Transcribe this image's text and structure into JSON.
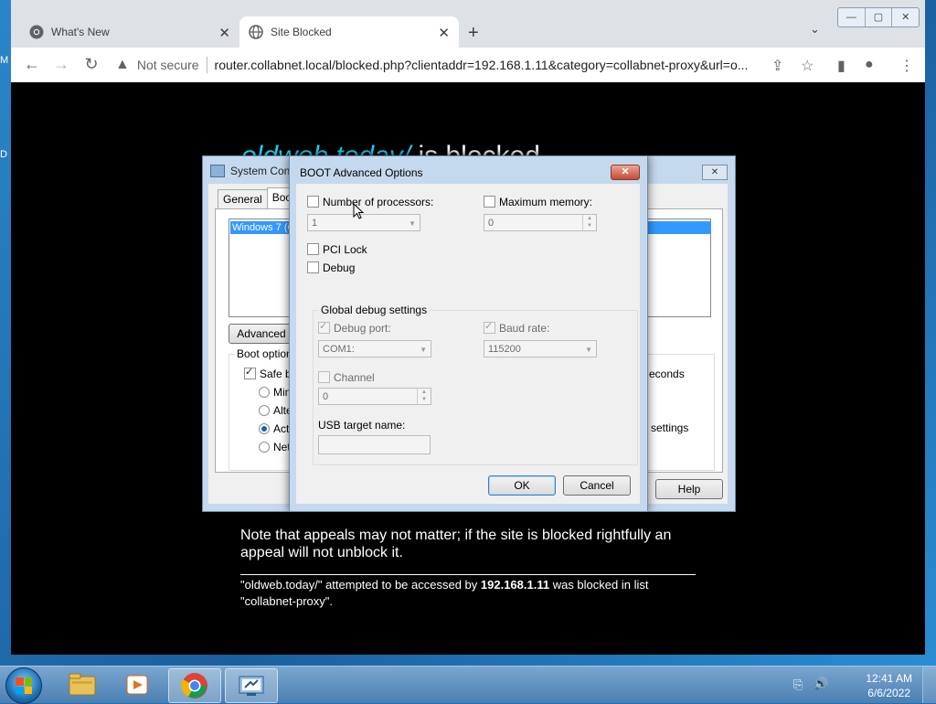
{
  "desktop": {
    "edge_letters": [
      "M",
      "D"
    ]
  },
  "browser": {
    "tabs": [
      {
        "title": "What's New",
        "icon": "chrome-icon",
        "active": false
      },
      {
        "title": "Site Blocked",
        "icon": "globe-icon",
        "active": true
      }
    ],
    "window_controls": {
      "minimize": "—",
      "maximize": "▢",
      "close": "✕"
    },
    "omnibox": {
      "security_label": "Not secure",
      "url": "router.collabnet.local/blocked.php?clientaddr=192.168.1.11&category=collabnet-proxy&url=o..."
    }
  },
  "page": {
    "heading_link": "oldweb.today/",
    "heading_rest": " is blocked",
    "note": "Note that appeals may not matter; if the site is blocked rightfully an appeal will not unblock it.",
    "attempt_pre": "\"oldweb.today/\" attempted to be accessed by ",
    "attempt_ip": "192.168.1.11",
    "attempt_mid": " was blocked in list",
    "attempt_list": "\"collabnet-proxy\"."
  },
  "system_config": {
    "title": "System Conf",
    "tabs": [
      "General",
      "Boot"
    ],
    "os_entry": "Windows 7 (C",
    "advanced_button": "Advanced o",
    "boot_options_label": "Boot options",
    "safe_boot_label": "Safe bo",
    "safe_boot_checked": true,
    "radios": [
      {
        "label": "Mini",
        "selected": false
      },
      {
        "label": "Alte",
        "selected": false
      },
      {
        "label": "Activ",
        "selected": true
      },
      {
        "label": "Netw",
        "selected": false
      }
    ],
    "timeout_suffix": "econds",
    "settings_label": "settings",
    "help_button": "Help"
  },
  "advanced_dialog": {
    "title": "BOOT Advanced Options",
    "close": "✕",
    "num_processors_label": "Number of processors:",
    "num_processors_checked": false,
    "num_processors_value": "1",
    "max_memory_label": "Maximum memory:",
    "max_memory_checked": false,
    "max_memory_value": "0",
    "pci_lock_label": "PCI Lock",
    "pci_lock_checked": false,
    "debug_label": "Debug",
    "debug_checked": false,
    "global_debug_label": "Global debug settings",
    "debug_port_label": "Debug port:",
    "debug_port_checked": true,
    "debug_port_value": "COM1:",
    "baud_rate_label": "Baud rate:",
    "baud_rate_checked": true,
    "baud_rate_value": "115200",
    "channel_label": "Channel",
    "channel_checked": false,
    "channel_value": "0",
    "usb_target_label": "USB target name:",
    "usb_target_value": "",
    "ok_button": "OK",
    "cancel_button": "Cancel"
  },
  "taskbar": {
    "items": [
      "windows-explorer-icon",
      "media-player-icon",
      "chrome-icon",
      "system-configuration-icon"
    ],
    "time": "12:41 AM",
    "date": "6/6/2022"
  }
}
